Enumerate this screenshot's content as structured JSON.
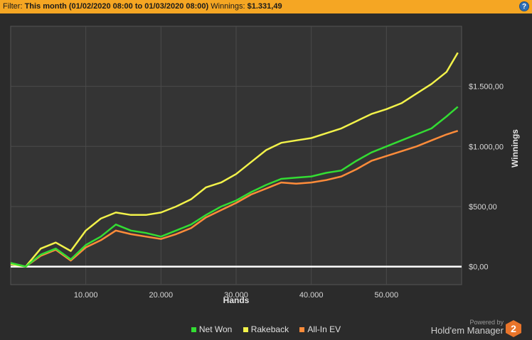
{
  "filter": {
    "prefix": "Filter:",
    "value": "This month (01/02/2020 08:00 to 01/03/2020 08:00)",
    "winnings_label": "Winnings:",
    "winnings_value": "$1.331,49"
  },
  "help": {
    "glyph": "?"
  },
  "branding": {
    "powered_by": "Powered by",
    "name": "Hold'em Manager",
    "logo_text": "2"
  },
  "colors": {
    "net_won": "#33dd33",
    "rakeback": "#f2f24a",
    "allin_ev": "#ff8c3a",
    "zero_line": "#ffffff",
    "logo": "#e8742a"
  },
  "chart_data": {
    "type": "line",
    "xlabel": "Hands",
    "ylabel": "Winnings",
    "xlim": [
      0,
      60000
    ],
    "ylim": [
      -150,
      2000
    ],
    "x_ticks": [
      10000,
      20000,
      30000,
      40000,
      50000
    ],
    "x_tick_labels": [
      "10.000",
      "20.000",
      "30.000",
      "40.000",
      "50.000"
    ],
    "y_ticks": [
      0,
      500,
      1000,
      1500
    ],
    "y_tick_labels": [
      "$0,00",
      "$500,00",
      "$1.000,00",
      "$1.500,00"
    ],
    "grid": true,
    "legend_position": "bottom",
    "x": [
      0,
      2000,
      4000,
      6000,
      8000,
      10000,
      12000,
      14000,
      16000,
      18000,
      20000,
      22000,
      24000,
      26000,
      28000,
      30000,
      32000,
      34000,
      36000,
      38000,
      40000,
      42000,
      44000,
      46000,
      48000,
      50000,
      52000,
      54000,
      56000,
      58000,
      59500
    ],
    "series": [
      {
        "name": "Net Won",
        "color": "#33dd33",
        "values": [
          30,
          0,
          100,
          150,
          60,
          180,
          250,
          350,
          300,
          280,
          250,
          300,
          350,
          430,
          500,
          550,
          620,
          680,
          730,
          740,
          750,
          780,
          800,
          880,
          950,
          1000,
          1050,
          1100,
          1150,
          1250,
          1330
        ]
      },
      {
        "name": "Rakeback",
        "color": "#f2f24a",
        "values": [
          20,
          0,
          150,
          200,
          130,
          300,
          400,
          450,
          430,
          430,
          450,
          500,
          560,
          660,
          700,
          770,
          870,
          970,
          1030,
          1050,
          1070,
          1110,
          1150,
          1210,
          1270,
          1310,
          1360,
          1440,
          1520,
          1620,
          1780
        ]
      },
      {
        "name": "All-In EV",
        "color": "#ff8c3a",
        "values": [
          30,
          0,
          90,
          140,
          50,
          160,
          220,
          300,
          270,
          250,
          230,
          270,
          320,
          410,
          470,
          530,
          600,
          650,
          700,
          690,
          700,
          720,
          750,
          810,
          880,
          920,
          960,
          1000,
          1050,
          1100,
          1130
        ]
      }
    ]
  }
}
